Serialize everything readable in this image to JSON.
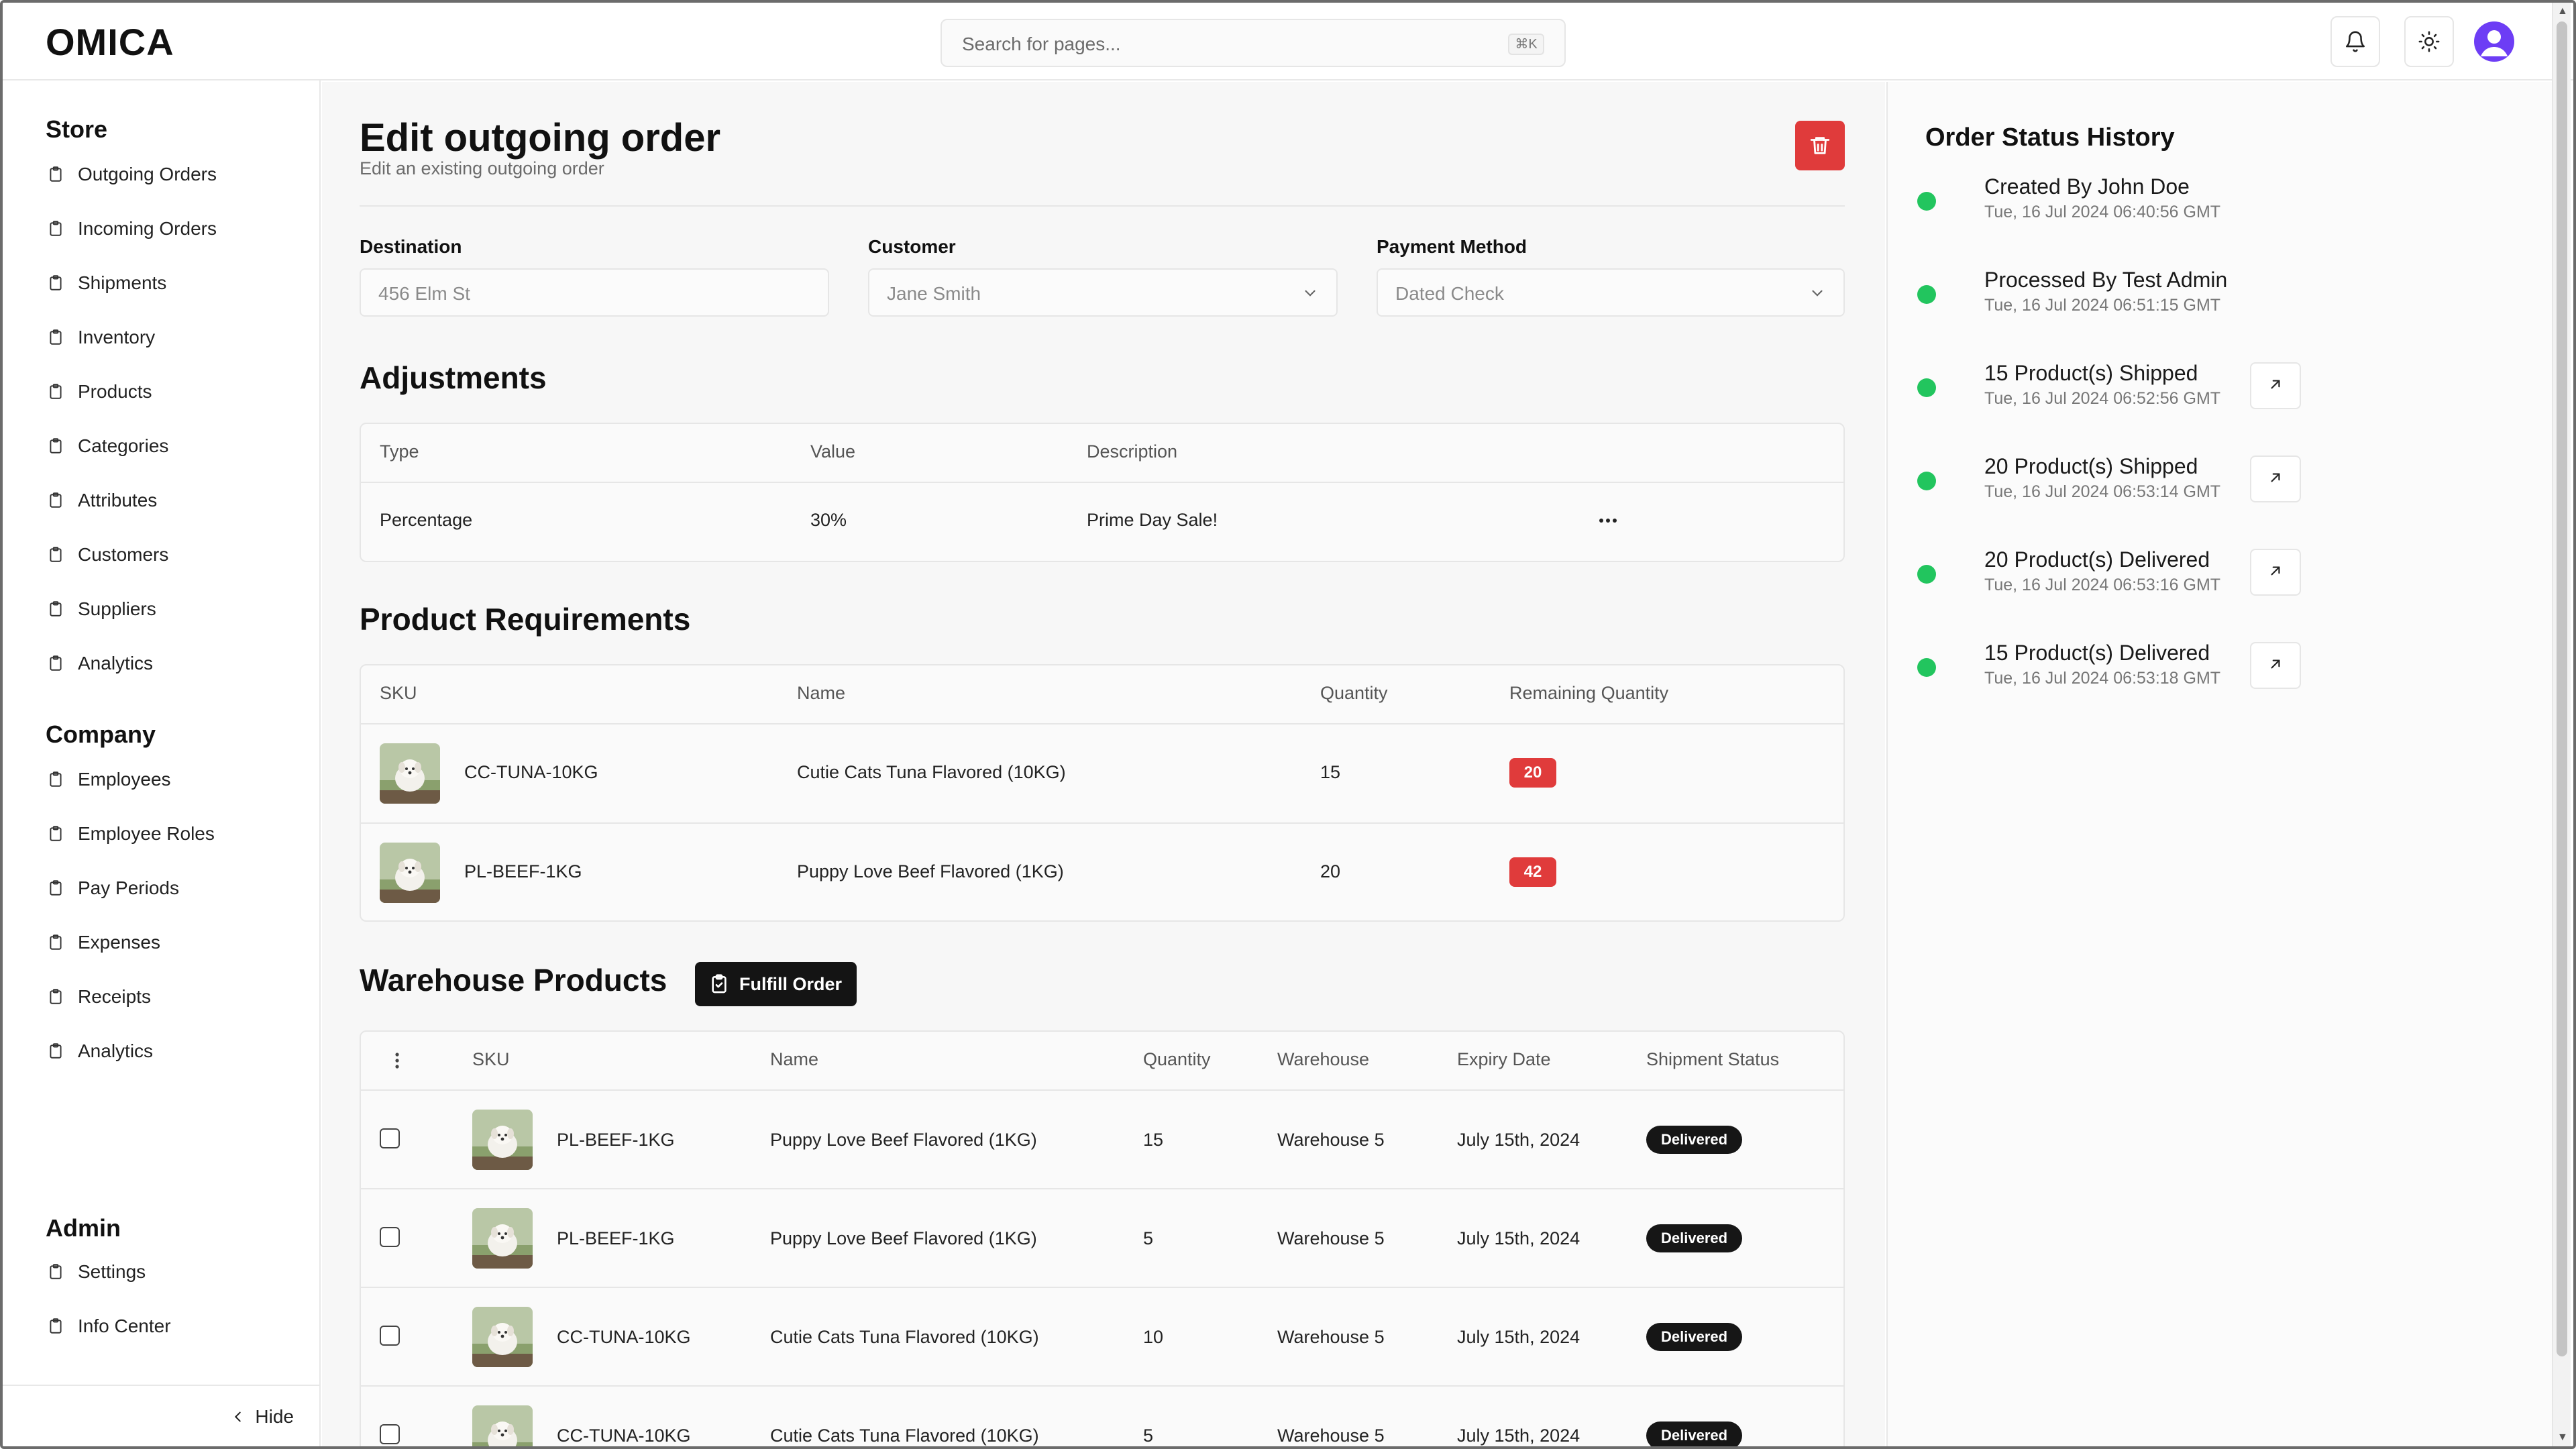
{
  "app": {
    "logo": "OMICA"
  },
  "search": {
    "placeholder": "Search for pages...",
    "shortcut": "⌘K"
  },
  "sidebar": {
    "sections": [
      {
        "title": "Store",
        "items": [
          "Outgoing Orders",
          "Incoming Orders",
          "Shipments",
          "Inventory",
          "Products",
          "Categories",
          "Attributes",
          "Customers",
          "Suppliers",
          "Analytics"
        ]
      },
      {
        "title": "Company",
        "items": [
          "Employees",
          "Employee Roles",
          "Pay Periods",
          "Expenses",
          "Receipts",
          "Analytics"
        ]
      },
      {
        "title": "Admin",
        "items": [
          "Settings",
          "Info Center"
        ]
      }
    ],
    "hide_label": "Hide"
  },
  "page": {
    "title": "Edit outgoing order",
    "subtitle": "Edit an existing outgoing order",
    "fields": {
      "destination": {
        "label": "Destination",
        "value": "456 Elm St"
      },
      "customer": {
        "label": "Customer",
        "value": "Jane Smith"
      },
      "payment": {
        "label": "Payment Method",
        "value": "Dated Check"
      }
    }
  },
  "adjustments": {
    "title": "Adjustments",
    "headers": [
      "Type",
      "Value",
      "Description"
    ],
    "rows": [
      {
        "type": "Percentage",
        "value": "30%",
        "description": "Prime Day Sale!"
      }
    ]
  },
  "requirements": {
    "title": "Product Requirements",
    "headers": [
      "SKU",
      "Name",
      "Quantity",
      "Remaining Quantity"
    ],
    "rows": [
      {
        "sku": "CC-TUNA-10KG",
        "name": "Cutie Cats Tuna Flavored (10KG)",
        "quantity": "15",
        "remaining": "20"
      },
      {
        "sku": "PL-BEEF-1KG",
        "name": "Puppy Love Beef Flavored (1KG)",
        "quantity": "20",
        "remaining": "42"
      }
    ]
  },
  "warehouse": {
    "title": "Warehouse Products",
    "fulfill_label": "Fulfill Order",
    "headers": [
      "SKU",
      "Name",
      "Quantity",
      "Warehouse",
      "Expiry Date",
      "Shipment Status"
    ],
    "rows": [
      {
        "sku": "PL-BEEF-1KG",
        "name": "Puppy Love Beef Flavored (1KG)",
        "quantity": "15",
        "warehouse": "Warehouse 5",
        "expiry": "July 15th, 2024",
        "status": "Delivered"
      },
      {
        "sku": "PL-BEEF-1KG",
        "name": "Puppy Love Beef Flavored (1KG)",
        "quantity": "5",
        "warehouse": "Warehouse 5",
        "expiry": "July 15th, 2024",
        "status": "Delivered"
      },
      {
        "sku": "CC-TUNA-10KG",
        "name": "Cutie Cats Tuna Flavored (10KG)",
        "quantity": "10",
        "warehouse": "Warehouse 5",
        "expiry": "July 15th, 2024",
        "status": "Delivered"
      },
      {
        "sku": "CC-TUNA-10KG",
        "name": "Cutie Cats Tuna Flavored (10KG)",
        "quantity": "5",
        "warehouse": "Warehouse 5",
        "expiry": "July 15th, 2024",
        "status": "Delivered"
      }
    ]
  },
  "history": {
    "title": "Order Status History",
    "items": [
      {
        "title": "Created By John Doe",
        "time": "Tue, 16 Jul 2024 06:40:56 GMT",
        "link": false
      },
      {
        "title": "Processed By Test Admin",
        "time": "Tue, 16 Jul 2024 06:51:15 GMT",
        "link": false
      },
      {
        "title": "15 Product(s) Shipped",
        "time": "Tue, 16 Jul 2024 06:52:56 GMT",
        "link": true
      },
      {
        "title": "20 Product(s) Shipped",
        "time": "Tue, 16 Jul 2024 06:53:14 GMT",
        "link": true
      },
      {
        "title": "20 Product(s) Delivered",
        "time": "Tue, 16 Jul 2024 06:53:16 GMT",
        "link": true
      },
      {
        "title": "15 Product(s) Delivered",
        "time": "Tue, 16 Jul 2024 06:53:18 GMT",
        "link": true
      }
    ]
  },
  "colors": {
    "accent_red": "#e03b3b",
    "status_green": "#22c55e",
    "badge_dark": "#161616"
  }
}
